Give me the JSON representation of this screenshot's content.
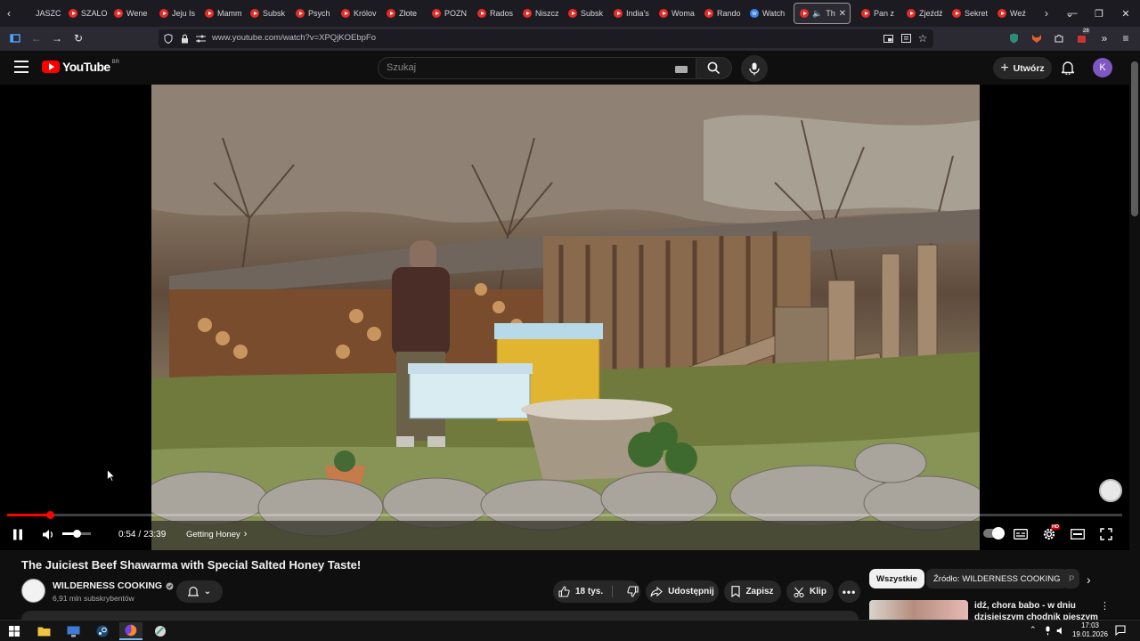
{
  "browser": {
    "tabs": [
      {
        "label": "JASZC",
        "icon": "none"
      },
      {
        "label": "SZALO",
        "icon": "youtube"
      },
      {
        "label": "Wene",
        "icon": "youtube"
      },
      {
        "label": "Jeju Is",
        "icon": "youtube"
      },
      {
        "label": "Mamm",
        "icon": "youtube"
      },
      {
        "label": "Subsk",
        "icon": "youtube"
      },
      {
        "label": "Psych",
        "icon": "youtube"
      },
      {
        "label": "Królov",
        "icon": "youtube"
      },
      {
        "label": "Złote",
        "icon": "youtube"
      },
      {
        "label": "POZN",
        "icon": "youtube"
      },
      {
        "label": "Rados",
        "icon": "youtube"
      },
      {
        "label": "Niszcz",
        "icon": "youtube"
      },
      {
        "label": "Subsk",
        "icon": "youtube"
      },
      {
        "label": "India's",
        "icon": "youtube"
      },
      {
        "label": "Woma",
        "icon": "youtube"
      },
      {
        "label": "Rando",
        "icon": "youtube"
      },
      {
        "label": "Watch",
        "icon": "watch"
      }
    ],
    "active_tab": {
      "label": "The",
      "icon": "youtube"
    },
    "tabs_after": [
      {
        "label": "Pan z",
        "icon": "youtube"
      },
      {
        "label": "Zjeźdź",
        "icon": "youtube"
      },
      {
        "label": "Sekret",
        "icon": "youtube"
      },
      {
        "label": "Weź",
        "icon": "youtube"
      }
    ],
    "url": "www.youtube.com/watch?v=XPQjKOEbpFo",
    "extension_badge": "28"
  },
  "youtube": {
    "logo_text": "YouTube",
    "country_code": "BR",
    "search_placeholder": "Szukaj",
    "create_label": "Utwórz",
    "avatar_letter": "K"
  },
  "player": {
    "current_time": "0:54",
    "time_separator": "/",
    "duration": "23:39",
    "chapter": "Getting Honey",
    "progress_fraction": 0.038,
    "volume_fraction": 0.5,
    "settings_badge": "HD"
  },
  "video": {
    "title": "The Juiciest Beef Shawarma with Special Salted Honey Taste!",
    "channel_name": "WILDERNESS COOKING",
    "subscribers": "6,91 mln subskrybentów",
    "likes": "18 tys.",
    "share_label": "Udostępnij",
    "save_label": "Zapisz",
    "clip_label": "Klip"
  },
  "sidebar": {
    "chips": [
      "Wszystkie",
      "Źródło: WILDERNESS COOKING",
      "P"
    ],
    "recommended_title": "idź, chora babo - w dniu dzisiejszym chodnik pieszym"
  },
  "taskbar": {
    "time": "17:03",
    "date": "19.01.2026"
  },
  "colors": {
    "accent": "#ff0000",
    "background": "#0f0f0f",
    "pill": "#272727",
    "avatar": "#7e57c2"
  }
}
